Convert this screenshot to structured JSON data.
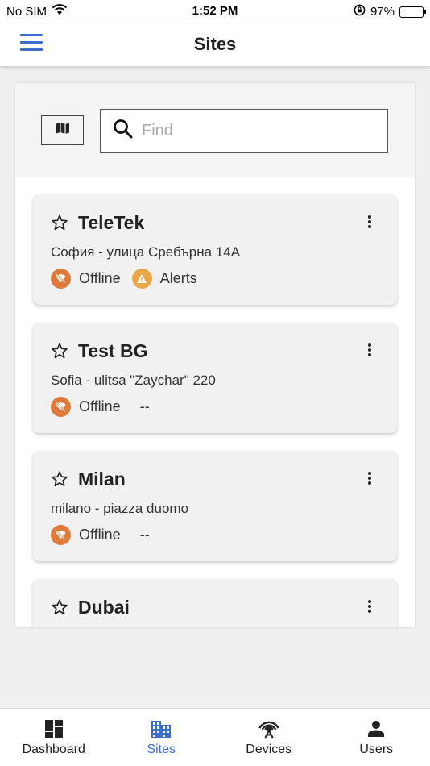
{
  "status_bar": {
    "carrier": "No SIM",
    "time": "1:52 PM",
    "battery": "97%",
    "battery_level": 0.97
  },
  "header": {
    "title": "Sites"
  },
  "search": {
    "placeholder": "Find",
    "value": ""
  },
  "sites": [
    {
      "name": "TeleTek",
      "address": "София - улица Сребърна 14А",
      "status": "Offline",
      "alert": "Alerts",
      "alert_present": true
    },
    {
      "name": "Test BG",
      "address": "Sofia - ulitsa \"Zaychar\" 220",
      "status": "Offline",
      "alert": "--",
      "alert_present": false
    },
    {
      "name": "Milan",
      "address": "milano - piazza duomo",
      "status": "Offline",
      "alert": "--",
      "alert_present": false
    },
    {
      "name": "Dubai",
      "address": "",
      "status": "",
      "alert": "",
      "alert_present": false
    }
  ],
  "tabs": [
    {
      "label": "Dashboard",
      "icon": "dashboard-icon",
      "active": false
    },
    {
      "label": "Sites",
      "icon": "building-icon",
      "active": true
    },
    {
      "label": "Devices",
      "icon": "antenna-icon",
      "active": false
    },
    {
      "label": "Users",
      "icon": "person-icon",
      "active": false
    }
  ],
  "colors": {
    "accent": "#3a6fd0",
    "offline": "#e07a3a",
    "alert": "#e8a84a"
  }
}
